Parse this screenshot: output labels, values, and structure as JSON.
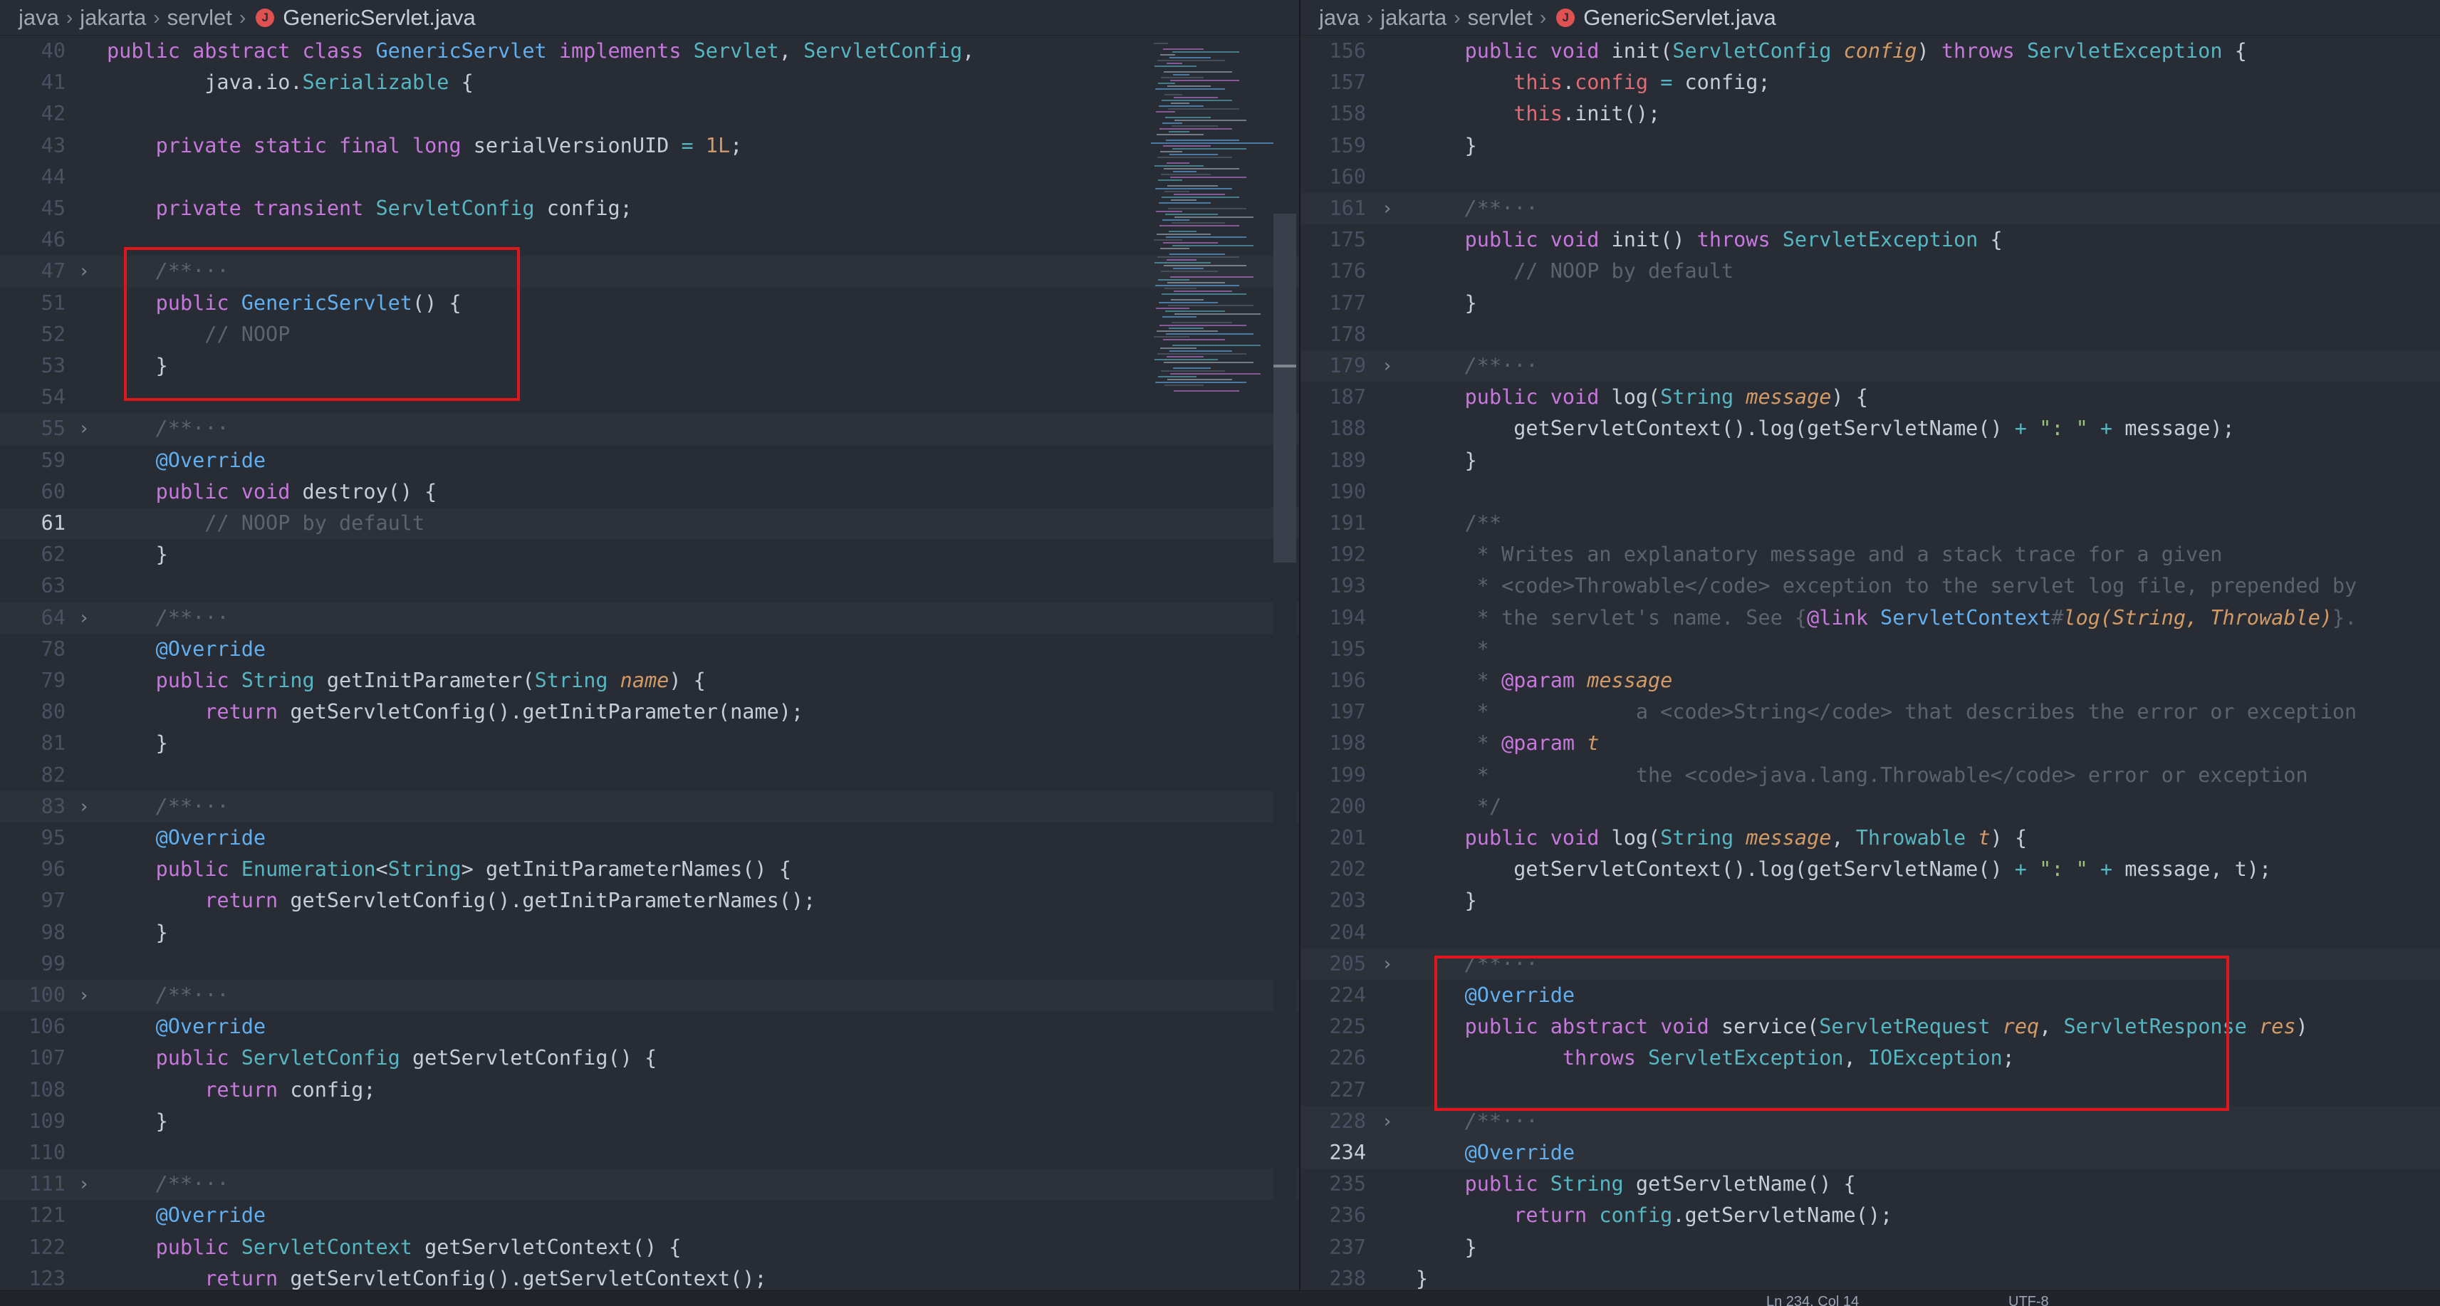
{
  "left_pane": {
    "breadcrumb": [
      "java",
      "jakarta",
      "servlet"
    ],
    "file_name": "GenericServlet.java",
    "active_line": "61",
    "lines": [
      {
        "n": "40",
        "tokens": [
          [
            "kw",
            "public "
          ],
          [
            "kw",
            "abstract "
          ],
          [
            "kw",
            "class "
          ],
          [
            "ty2",
            "GenericServlet "
          ],
          [
            "kw",
            "implements "
          ],
          [
            "ty",
            "Servlet"
          ],
          [
            "fn",
            ", "
          ],
          [
            "ty",
            "ServletConfig"
          ],
          [
            "fn",
            ","
          ]
        ]
      },
      {
        "n": "41",
        "tokens": [
          [
            "fn",
            "        java.io."
          ],
          [
            "ty",
            "Serializable "
          ],
          [
            "fn",
            "{"
          ]
        ]
      },
      {
        "n": "42",
        "tokens": []
      },
      {
        "n": "43",
        "tokens": [
          [
            "kw",
            "    private "
          ],
          [
            "kw",
            "static "
          ],
          [
            "kw",
            "final "
          ],
          [
            "kw",
            "long "
          ],
          [
            "fn",
            "serialVersionUID "
          ],
          [
            "op",
            "= "
          ],
          [
            "num",
            "1L"
          ],
          [
            "fn",
            ";"
          ]
        ]
      },
      {
        "n": "44",
        "tokens": []
      },
      {
        "n": "45",
        "tokens": [
          [
            "kw",
            "    private "
          ],
          [
            "kw",
            "transient "
          ],
          [
            "ty",
            "ServletConfig "
          ],
          [
            "fn",
            "config;"
          ]
        ]
      },
      {
        "n": "46",
        "tokens": []
      },
      {
        "n": "47",
        "fold": true,
        "tokens": [
          [
            "cm-i",
            "    /**"
          ],
          [
            "cm",
            "···"
          ]
        ]
      },
      {
        "n": "51",
        "tokens": [
          [
            "kw",
            "    public "
          ],
          [
            "ty2",
            "GenericServlet"
          ],
          [
            "fn",
            "() {"
          ]
        ]
      },
      {
        "n": "52",
        "tokens": [
          [
            "cm",
            "        // NOOP"
          ]
        ]
      },
      {
        "n": "53",
        "tokens": [
          [
            "fn",
            "    }"
          ]
        ]
      },
      {
        "n": "54",
        "tokens": []
      },
      {
        "n": "55",
        "fold": true,
        "tokens": [
          [
            "cm-i",
            "    /**"
          ],
          [
            "cm",
            "···"
          ]
        ]
      },
      {
        "n": "59",
        "tokens": [
          [
            "an",
            "    @Override"
          ]
        ]
      },
      {
        "n": "60",
        "tokens": [
          [
            "kw",
            "    public "
          ],
          [
            "kw",
            "void "
          ],
          [
            "fn",
            "destroy() {"
          ]
        ]
      },
      {
        "n": "61",
        "tokens": [
          [
            "cm",
            "        // NOOP by default"
          ]
        ]
      },
      {
        "n": "62",
        "tokens": [
          [
            "fn",
            "    }"
          ]
        ]
      },
      {
        "n": "63",
        "tokens": []
      },
      {
        "n": "64",
        "fold": true,
        "tokens": [
          [
            "cm-i",
            "    /**"
          ],
          [
            "cm",
            "···"
          ]
        ]
      },
      {
        "n": "78",
        "tokens": [
          [
            "an",
            "    @Override"
          ]
        ]
      },
      {
        "n": "79",
        "tokens": [
          [
            "kw",
            "    public "
          ],
          [
            "ty",
            "String "
          ],
          [
            "fn",
            "getInitParameter("
          ],
          [
            "ty",
            "String "
          ],
          [
            "param",
            "name"
          ],
          [
            "fn",
            ") {"
          ]
        ]
      },
      {
        "n": "80",
        "tokens": [
          [
            "kw",
            "        return "
          ],
          [
            "fn",
            "getServletConfig().getInitParameter(name);"
          ]
        ]
      },
      {
        "n": "81",
        "tokens": [
          [
            "fn",
            "    }"
          ]
        ]
      },
      {
        "n": "82",
        "tokens": []
      },
      {
        "n": "83",
        "fold": true,
        "tokens": [
          [
            "cm-i",
            "    /**"
          ],
          [
            "cm",
            "···"
          ]
        ]
      },
      {
        "n": "95",
        "tokens": [
          [
            "an",
            "    @Override"
          ]
        ]
      },
      {
        "n": "96",
        "tokens": [
          [
            "kw",
            "    public "
          ],
          [
            "ty",
            "Enumeration"
          ],
          [
            "fn",
            "<"
          ],
          [
            "ty",
            "String"
          ],
          [
            "fn",
            "> getInitParameterNames() {"
          ]
        ]
      },
      {
        "n": "97",
        "tokens": [
          [
            "kw",
            "        return "
          ],
          [
            "fn",
            "getServletConfig().getInitParameterNames();"
          ]
        ]
      },
      {
        "n": "98",
        "tokens": [
          [
            "fn",
            "    }"
          ]
        ]
      },
      {
        "n": "99",
        "tokens": []
      },
      {
        "n": "100",
        "fold": true,
        "tokens": [
          [
            "cm-i",
            "    /**"
          ],
          [
            "cm",
            "···"
          ]
        ]
      },
      {
        "n": "106",
        "tokens": [
          [
            "an",
            "    @Override"
          ]
        ]
      },
      {
        "n": "107",
        "tokens": [
          [
            "kw",
            "    public "
          ],
          [
            "ty",
            "ServletConfig "
          ],
          [
            "fn",
            "getServletConfig() {"
          ]
        ]
      },
      {
        "n": "108",
        "tokens": [
          [
            "kw",
            "        return "
          ],
          [
            "fn",
            "config;"
          ]
        ]
      },
      {
        "n": "109",
        "tokens": [
          [
            "fn",
            "    }"
          ]
        ]
      },
      {
        "n": "110",
        "tokens": []
      },
      {
        "n": "111",
        "fold": true,
        "tokens": [
          [
            "cm-i",
            "    /**"
          ],
          [
            "cm",
            "···"
          ]
        ]
      },
      {
        "n": "121",
        "tokens": [
          [
            "an",
            "    @Override"
          ]
        ]
      },
      {
        "n": "122",
        "tokens": [
          [
            "kw",
            "    public "
          ],
          [
            "ty",
            "ServletContext "
          ],
          [
            "fn",
            "getServletContext() {"
          ]
        ]
      },
      {
        "n": "123",
        "tokens": [
          [
            "kw",
            "        return "
          ],
          [
            "fn",
            "getServletConfig().getServletContext();"
          ]
        ]
      }
    ]
  },
  "right_pane": {
    "breadcrumb": [
      "java",
      "jakarta",
      "servlet"
    ],
    "file_name": "GenericServlet.java",
    "active_line": "234",
    "lines": [
      {
        "n": "156",
        "tokens": [
          [
            "kw",
            "    public "
          ],
          [
            "kw",
            "void "
          ],
          [
            "fn",
            "init("
          ],
          [
            "ty",
            "ServletConfig "
          ],
          [
            "param",
            "config"
          ],
          [
            "fn",
            ") "
          ],
          [
            "kw",
            "throws "
          ],
          [
            "ty",
            "ServletException "
          ],
          [
            "fn",
            "{"
          ]
        ]
      },
      {
        "n": "157",
        "tokens": [
          [
            "this",
            "        this"
          ],
          [
            "fn",
            "."
          ],
          [
            "this",
            "config "
          ],
          [
            "op",
            "= "
          ],
          [
            "fn",
            "config;"
          ]
        ]
      },
      {
        "n": "158",
        "tokens": [
          [
            "this",
            "        this"
          ],
          [
            "fn",
            ".init();"
          ]
        ]
      },
      {
        "n": "159",
        "tokens": [
          [
            "fn",
            "    }"
          ]
        ]
      },
      {
        "n": "160",
        "tokens": []
      },
      {
        "n": "161",
        "fold": true,
        "tokens": [
          [
            "cm-i",
            "    /**"
          ],
          [
            "cm",
            "···"
          ]
        ]
      },
      {
        "n": "175",
        "tokens": [
          [
            "kw",
            "    public "
          ],
          [
            "kw",
            "void "
          ],
          [
            "fn",
            "init() "
          ],
          [
            "kw",
            "throws "
          ],
          [
            "ty",
            "ServletException "
          ],
          [
            "fn",
            "{"
          ]
        ]
      },
      {
        "n": "176",
        "tokens": [
          [
            "cm",
            "        // NOOP by default"
          ]
        ]
      },
      {
        "n": "177",
        "tokens": [
          [
            "fn",
            "    }"
          ]
        ]
      },
      {
        "n": "178",
        "tokens": []
      },
      {
        "n": "179",
        "fold": true,
        "tokens": [
          [
            "cm-i",
            "    /**"
          ],
          [
            "cm",
            "···"
          ]
        ]
      },
      {
        "n": "187",
        "tokens": [
          [
            "kw",
            "    public "
          ],
          [
            "kw",
            "void "
          ],
          [
            "fn",
            "log("
          ],
          [
            "ty",
            "String "
          ],
          [
            "param",
            "message"
          ],
          [
            "fn",
            ") {"
          ]
        ]
      },
      {
        "n": "188",
        "tokens": [
          [
            "fn",
            "        getServletContext().log(getServletName() "
          ],
          [
            "op",
            "+ "
          ],
          [
            "str",
            "\": \" "
          ],
          [
            "op",
            "+ "
          ],
          [
            "fn",
            "message);"
          ]
        ]
      },
      {
        "n": "189",
        "tokens": [
          [
            "fn",
            "    }"
          ]
        ]
      },
      {
        "n": "190",
        "tokens": []
      },
      {
        "n": "191",
        "tokens": [
          [
            "cm",
            "    /**"
          ]
        ]
      },
      {
        "n": "192",
        "tokens": [
          [
            "cm",
            "     * Writes an explanatory message and a stack trace for a given"
          ]
        ]
      },
      {
        "n": "193",
        "tokens": [
          [
            "cm",
            "     * <code>Throwable</code> exception to the servlet log file, prepended by"
          ]
        ]
      },
      {
        "n": "194",
        "tokens": [
          [
            "cm",
            "     * the servlet's name. See {"
          ],
          [
            "jd-tag",
            "@link "
          ],
          [
            "jd-link",
            "ServletContext"
          ],
          [
            "cm",
            "#"
          ],
          [
            "jd-par",
            "log(String, Throwable)"
          ],
          [
            "cm",
            "}."
          ]
        ]
      },
      {
        "n": "195",
        "tokens": [
          [
            "cm",
            "     *"
          ]
        ]
      },
      {
        "n": "196",
        "tokens": [
          [
            "cm",
            "     * "
          ],
          [
            "jd-tag",
            "@param "
          ],
          [
            "jd-par",
            "message"
          ]
        ]
      },
      {
        "n": "197",
        "tokens": [
          [
            "cm",
            "     *            a <code>String</code> that describes the error or exception"
          ]
        ]
      },
      {
        "n": "198",
        "tokens": [
          [
            "cm",
            "     * "
          ],
          [
            "jd-tag",
            "@param "
          ],
          [
            "jd-par",
            "t"
          ]
        ]
      },
      {
        "n": "199",
        "tokens": [
          [
            "cm",
            "     *            the <code>java.lang.Throwable</code> error or exception"
          ]
        ]
      },
      {
        "n": "200",
        "tokens": [
          [
            "cm",
            "     */"
          ]
        ]
      },
      {
        "n": "201",
        "tokens": [
          [
            "kw",
            "    public "
          ],
          [
            "kw",
            "void "
          ],
          [
            "fn",
            "log("
          ],
          [
            "ty",
            "String "
          ],
          [
            "param",
            "message"
          ],
          [
            "fn",
            ", "
          ],
          [
            "ty",
            "Throwable "
          ],
          [
            "param",
            "t"
          ],
          [
            "fn",
            ") {"
          ]
        ]
      },
      {
        "n": "202",
        "tokens": [
          [
            "fn",
            "        getServletContext().log(getServletName() "
          ],
          [
            "op",
            "+ "
          ],
          [
            "str",
            "\": \" "
          ],
          [
            "op",
            "+ "
          ],
          [
            "fn",
            "message, t);"
          ]
        ]
      },
      {
        "n": "203",
        "tokens": [
          [
            "fn",
            "    }"
          ]
        ]
      },
      {
        "n": "204",
        "tokens": []
      },
      {
        "n": "205",
        "fold": true,
        "tokens": [
          [
            "cm-i",
            "    /**"
          ],
          [
            "cm",
            "···"
          ]
        ]
      },
      {
        "n": "224",
        "tokens": [
          [
            "an",
            "    @Override"
          ]
        ]
      },
      {
        "n": "225",
        "tokens": [
          [
            "kw",
            "    public "
          ],
          [
            "kw",
            "abstract "
          ],
          [
            "kw",
            "void "
          ],
          [
            "fn",
            "service("
          ],
          [
            "ty",
            "ServletRequest "
          ],
          [
            "param",
            "req"
          ],
          [
            "fn",
            ", "
          ],
          [
            "ty",
            "ServletResponse "
          ],
          [
            "param",
            "res"
          ],
          [
            "fn",
            ")"
          ]
        ]
      },
      {
        "n": "226",
        "tokens": [
          [
            "kw",
            "            throws "
          ],
          [
            "ty",
            "ServletException"
          ],
          [
            "fn",
            ", "
          ],
          [
            "ty",
            "IOException"
          ],
          [
            "fn",
            ";"
          ]
        ]
      },
      {
        "n": "227",
        "tokens": []
      },
      {
        "n": "228",
        "fold": true,
        "tokens": [
          [
            "cm-i",
            "    /**"
          ],
          [
            "cm",
            "···"
          ]
        ]
      },
      {
        "n": "234",
        "tokens": [
          [
            "an",
            "    @Override"
          ]
        ]
      },
      {
        "n": "235",
        "tokens": [
          [
            "kw",
            "    public "
          ],
          [
            "ty",
            "String "
          ],
          [
            "fn",
            "getServletName() {"
          ]
        ]
      },
      {
        "n": "236",
        "tokens": [
          [
            "kw",
            "        return "
          ],
          [
            "ty",
            "config"
          ],
          [
            "fn",
            ".getServletName();"
          ]
        ]
      },
      {
        "n": "237",
        "tokens": [
          [
            "fn",
            "    }"
          ]
        ]
      },
      {
        "n": "238",
        "tokens": [
          [
            "fn",
            "}"
          ]
        ]
      }
    ]
  },
  "colors": {
    "background": "#282c34",
    "highlight_box": "#e0161b",
    "keyword": "#c678dd",
    "type": "#56b6c2",
    "comment": "#5c6370"
  },
  "status_bar": {
    "cursor": "Ln 234, Col 14",
    "encoding": "UTF-8"
  }
}
